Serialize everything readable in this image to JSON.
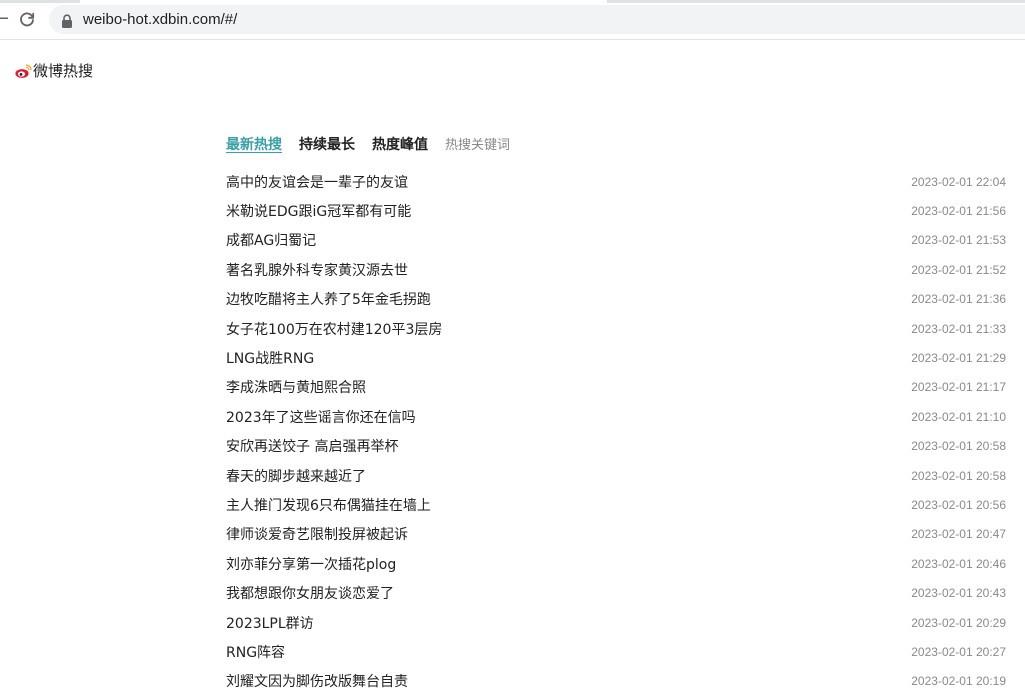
{
  "browser": {
    "url": "weibo-hot.xdbin.com/#/"
  },
  "site": {
    "name": "微博热搜"
  },
  "tabs": [
    {
      "label": "最新热搜",
      "active": true
    },
    {
      "label": "持续最长",
      "active": false
    },
    {
      "label": "热度峰值",
      "active": false
    },
    {
      "label": "热搜关键词",
      "active": false
    }
  ],
  "hot_list": [
    {
      "title": "高中的友谊会是一辈子的友谊",
      "time": "2023-02-01 22:04"
    },
    {
      "title": "米勒说EDG跟iG冠军都有可能",
      "time": "2023-02-01 21:56"
    },
    {
      "title": "成都AG归蜀记",
      "time": "2023-02-01 21:53"
    },
    {
      "title": "著名乳腺外科专家黄汉源去世",
      "time": "2023-02-01 21:52"
    },
    {
      "title": "边牧吃醋将主人养了5年金毛拐跑",
      "time": "2023-02-01 21:36"
    },
    {
      "title": "女子花100万在农村建120平3层房",
      "time": "2023-02-01 21:33"
    },
    {
      "title": "LNG战胜RNG",
      "time": "2023-02-01 21:29"
    },
    {
      "title": "李成洙晒与黄旭熙合照",
      "time": "2023-02-01 21:17"
    },
    {
      "title": "2023年了这些谣言你还在信吗",
      "time": "2023-02-01 21:10"
    },
    {
      "title": "安欣再送饺子 高启强再举杯",
      "time": "2023-02-01 20:58"
    },
    {
      "title": "春天的脚步越来越近了",
      "time": "2023-02-01 20:58"
    },
    {
      "title": "主人推门发现6只布偶猫挂在墙上",
      "time": "2023-02-01 20:56"
    },
    {
      "title": "律师谈爱奇艺限制投屏被起诉",
      "time": "2023-02-01 20:47"
    },
    {
      "title": "刘亦菲分享第一次插花plog",
      "time": "2023-02-01 20:46"
    },
    {
      "title": "我都想跟你女朋友谈恋爱了",
      "time": "2023-02-01 20:43"
    },
    {
      "title": "2023LPL群访",
      "time": "2023-02-01 20:29"
    },
    {
      "title": "RNG阵容",
      "time": "2023-02-01 20:27"
    },
    {
      "title": "刘耀文因为脚伤改版舞台自责",
      "time": "2023-02-01 20:19"
    }
  ],
  "colors": {
    "accent": "#39a0a5",
    "text": "#222222",
    "muted": "#8a8a8a",
    "weibo_red": "#e6162d"
  },
  "icons": {
    "reload": "reload-icon",
    "lock": "lock-icon",
    "logo": "weibo-logo-icon"
  }
}
